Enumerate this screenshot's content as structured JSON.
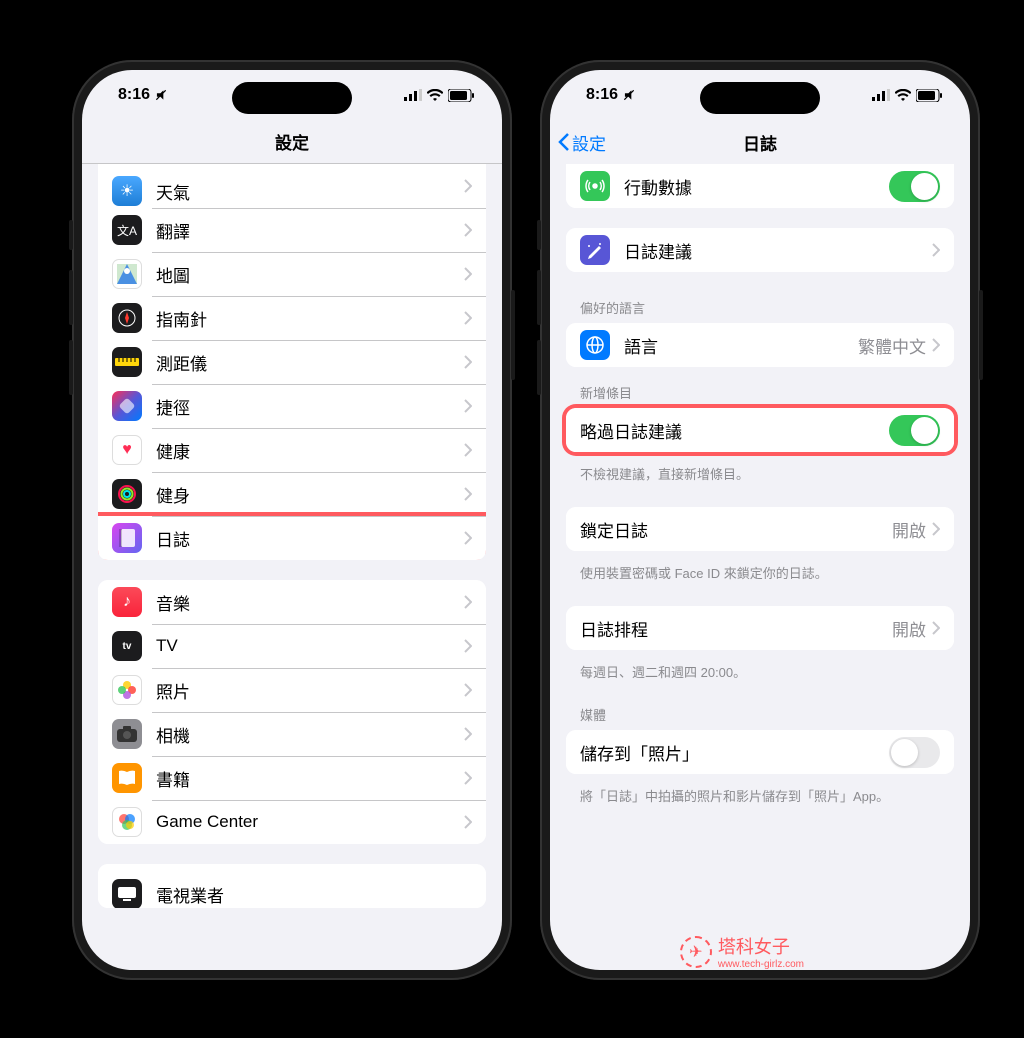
{
  "status": {
    "time": "8:16"
  },
  "left": {
    "title": "設定",
    "rows": [
      {
        "id": "weather",
        "label": "天氣"
      },
      {
        "id": "translate",
        "label": "翻譯"
      },
      {
        "id": "maps",
        "label": "地圖"
      },
      {
        "id": "compass",
        "label": "指南針"
      },
      {
        "id": "measure",
        "label": "測距儀"
      },
      {
        "id": "shortcuts",
        "label": "捷徑"
      },
      {
        "id": "health",
        "label": "健康"
      },
      {
        "id": "fitness",
        "label": "健身"
      },
      {
        "id": "journal",
        "label": "日誌"
      }
    ],
    "rows2": [
      {
        "id": "music",
        "label": "音樂"
      },
      {
        "id": "tv",
        "label": "TV"
      },
      {
        "id": "photos",
        "label": "照片"
      },
      {
        "id": "camera",
        "label": "相機"
      },
      {
        "id": "books",
        "label": "書籍"
      },
      {
        "id": "gamecenter",
        "label": "Game Center"
      }
    ],
    "rows3": [
      {
        "id": "provider",
        "label": "電視業者"
      }
    ]
  },
  "right": {
    "back": "設定",
    "title": "日誌",
    "cellular": "行動數據",
    "suggestions": "日誌建議",
    "lang_header": "偏好的語言",
    "language": "語言",
    "language_value": "繁體中文",
    "new_entry_header": "新增條目",
    "skip_suggestions": "略過日誌建議",
    "skip_footer": "不檢視建議，直接新增條目。",
    "lock": "鎖定日誌",
    "lock_value": "開啟",
    "lock_footer": "使用裝置密碼或 Face ID 來鎖定你的日誌。",
    "schedule": "日誌排程",
    "schedule_value": "開啟",
    "schedule_footer": "每週日、週二和週四 20:00。",
    "media_header": "媒體",
    "save_photos": "儲存到「照片」",
    "save_photos_footer": "將「日誌」中拍攝的照片和影片儲存到「照片」App。"
  },
  "watermark": {
    "name": "塔科女子",
    "url": "www.tech-girlz.com"
  }
}
